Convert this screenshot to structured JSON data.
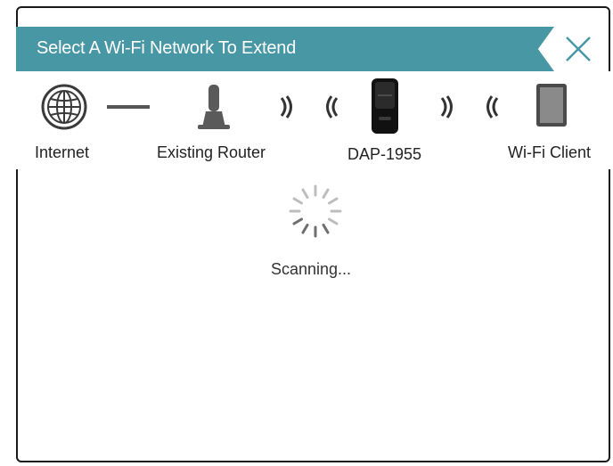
{
  "dialog": {
    "title": "Select A Wi-Fi Network To Extend",
    "close_icon": "close-icon",
    "accent_color": "#4797a5"
  },
  "topology": {
    "internet": {
      "label": "Internet",
      "icon": "globe-icon"
    },
    "router": {
      "label": "Existing Router",
      "icon": "router-icon"
    },
    "extender": {
      "label": "DAP-1955",
      "icon": "extender-device-icon"
    },
    "client": {
      "label": "Wi-Fi Client",
      "icon": "tablet-icon"
    }
  },
  "status": {
    "text": "Scanning...",
    "icon": "loading-spinner-icon"
  }
}
